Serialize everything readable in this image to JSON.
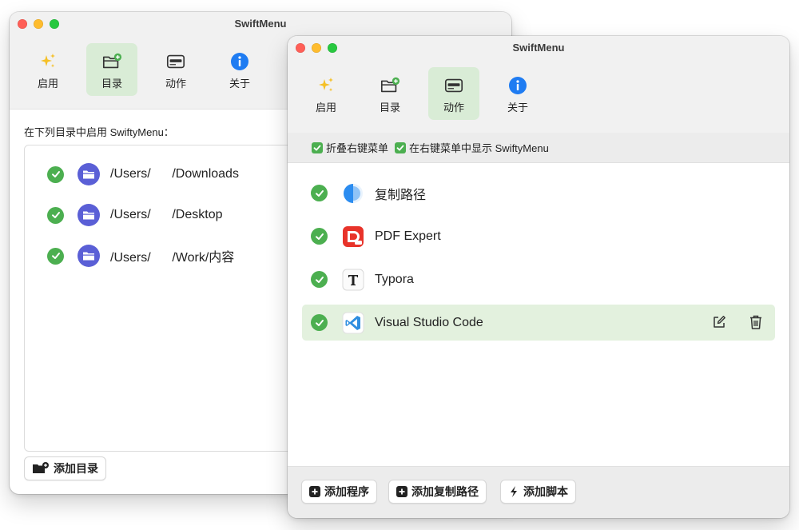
{
  "back_window": {
    "title": "SwiftMenu",
    "tabs": [
      {
        "label": "启用",
        "icon": "sparkles-icon"
      },
      {
        "label": "目录",
        "icon": "folder-add-icon",
        "active": true
      },
      {
        "label": "动作",
        "icon": "menu-panel-icon"
      },
      {
        "label": "关于",
        "icon": "info-icon"
      }
    ],
    "heading": "在下列目录中启用 SwiftyMenu：",
    "directories": [
      {
        "path": "/Users/      /Downloads",
        "enabled": true
      },
      {
        "path": "/Users/      /Desktop",
        "enabled": true
      },
      {
        "path": "/Users/      /Work/内容",
        "enabled": true
      }
    ],
    "add_button": "添加目录"
  },
  "front_window": {
    "title": "SwiftMenu",
    "tabs": [
      {
        "label": "启用",
        "icon": "sparkles-icon"
      },
      {
        "label": "目录",
        "icon": "folder-add-icon"
      },
      {
        "label": "动作",
        "icon": "menu-panel-icon",
        "active": true
      },
      {
        "label": "关于",
        "icon": "info-icon"
      }
    ],
    "options": [
      {
        "label": "折叠右键菜单",
        "checked": true
      },
      {
        "label": "在右键菜单中显示 SwiftyMenu",
        "checked": true
      }
    ],
    "actions": [
      {
        "name": "复制路径",
        "icon": "copy-path-icon",
        "enabled": true
      },
      {
        "name": "PDF Expert",
        "icon": "pdf-expert-icon",
        "enabled": true
      },
      {
        "name": "Typora",
        "icon": "typora-icon",
        "enabled": true
      },
      {
        "name": "Visual Studio Code",
        "icon": "vscode-icon",
        "enabled": true,
        "selected": true
      }
    ],
    "buttons": {
      "add_app": "添加程序",
      "add_copy_path": "添加复制路径",
      "add_script": "添加脚本"
    }
  },
  "colors": {
    "accent_green": "#4caf50",
    "selected_tab": "#d9ecd6",
    "selected_row": "#e3f1de",
    "folder_purple": "#5a5fd6",
    "info_blue": "#1f7cf2"
  }
}
